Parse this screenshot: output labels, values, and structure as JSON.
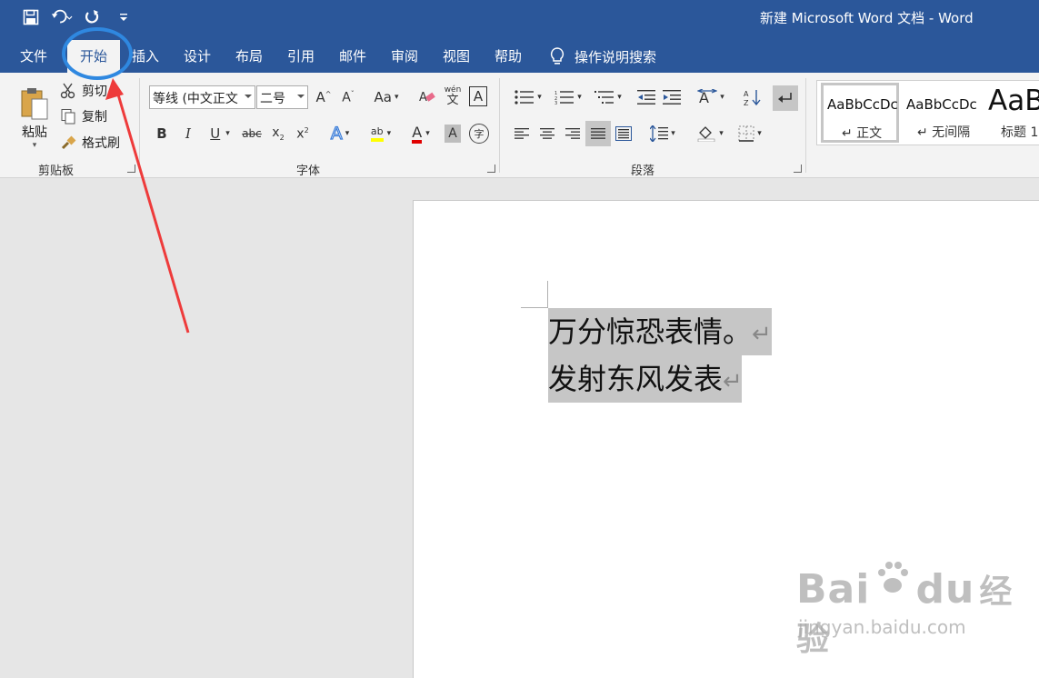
{
  "window": {
    "title": "新建 Microsoft Word 文档  -  Word"
  },
  "qat": {
    "icons": [
      "save-icon",
      "undo-icon",
      "redo-icon",
      "customize-qat-icon"
    ]
  },
  "tabs": [
    {
      "label": "文件"
    },
    {
      "label": "开始"
    },
    {
      "label": "插入"
    },
    {
      "label": "设计"
    },
    {
      "label": "布局"
    },
    {
      "label": "引用"
    },
    {
      "label": "邮件"
    },
    {
      "label": "审阅"
    },
    {
      "label": "视图"
    },
    {
      "label": "帮助"
    }
  ],
  "active_tab": "开始",
  "tell_me": {
    "label": "操作说明搜索",
    "icon": "lightbulb-icon"
  },
  "clipboard": {
    "paste": "粘贴",
    "cut": "剪切",
    "copy": "复制",
    "format_painter": "格式刷",
    "group": "剪贴板"
  },
  "font": {
    "name": "等线 (中文正文",
    "size": "二号",
    "change_case": "Aa",
    "group": "字体",
    "phonetic_top": "wén",
    "phonetic_bottom": "文",
    "char_border": "A",
    "enclose": "字"
  },
  "paragraph": {
    "group": "段落"
  },
  "styles": [
    {
      "sample": "AaBbCcDc",
      "name": "↵ 正文"
    },
    {
      "sample": "AaBbCcDc",
      "name": "↵ 无间隔"
    },
    {
      "sample": "AaB",
      "name": "标题 1"
    }
  ],
  "document": {
    "lines": [
      "万分惊恐表情。",
      "发射东风发表"
    ],
    "para_mark": "↵"
  },
  "watermark": {
    "main": "Bai",
    "main2": "du",
    "cn": "经验",
    "sub": "jingyan.baidu.com"
  },
  "colors": {
    "brand": "#2b579a",
    "annotation_circle": "#2f88e0",
    "annotation_arrow": "#ee3b3b",
    "highlight": "#c6c6c6"
  }
}
